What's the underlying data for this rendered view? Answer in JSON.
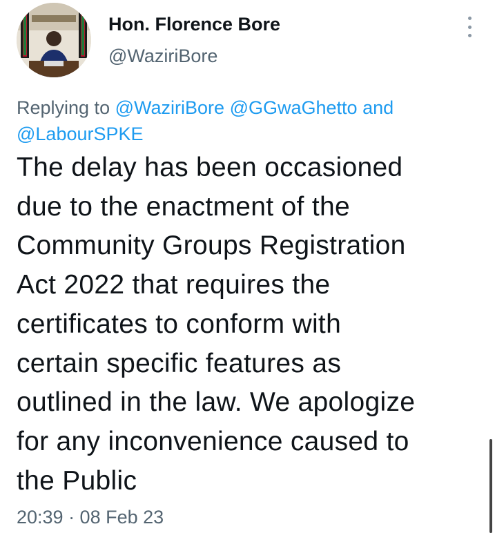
{
  "author": {
    "name": "Hon. Florence Bore",
    "handle": "@WaziriBore",
    "avatar_icon": "profile-photo"
  },
  "more_icon": "more-vertical-icon",
  "reply": {
    "prefix": "Replying to",
    "mentions": [
      "@WaziriBore",
      "@GGwaGhetto",
      "@LabourSPKE"
    ],
    "conjunction": "and"
  },
  "tweet_text": "The delay has been occasioned\ndue to the enactment of the\nCommunity Groups Registration\nAct 2022 that requires the\ncertificates  to conform with\ncertain specific features as\noutlined in the law. We apologize\nfor any inconvenience caused to\nthe Public",
  "timestamp": "20:39 · 08 Feb 23",
  "colors": {
    "text": "#0f1419",
    "secondary": "#536471",
    "link": "#1d9bf0",
    "background": "#ffffff"
  }
}
